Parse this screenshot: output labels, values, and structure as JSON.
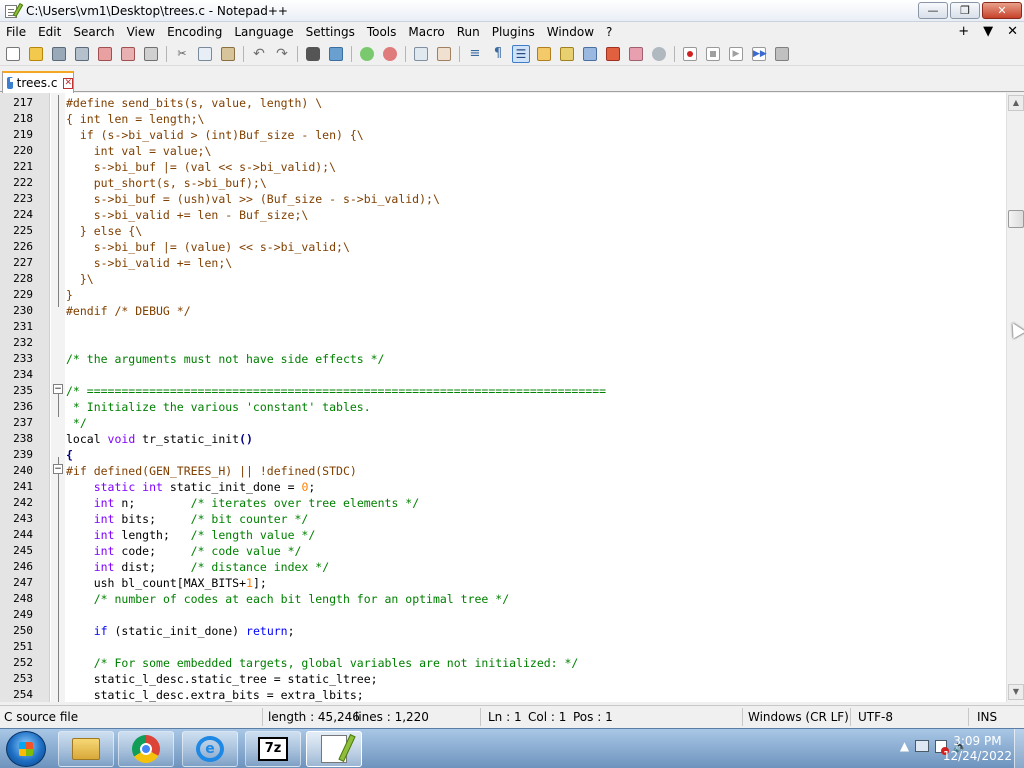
{
  "window": {
    "title": "C:\\Users\\vm1\\Desktop\\trees.c - Notepad++",
    "controls": {
      "minimize": "—",
      "maximize": "❐",
      "close": "✕"
    }
  },
  "menubar": {
    "items": [
      "File",
      "Edit",
      "Search",
      "View",
      "Encoding",
      "Language",
      "Settings",
      "Tools",
      "Macro",
      "Run",
      "Plugins",
      "Window",
      "?"
    ],
    "right": {
      "plus": "+",
      "down": "▼",
      "close": "✕"
    }
  },
  "toolbar": {
    "icons": [
      "new-file-icon",
      "open-file-icon",
      "save-icon",
      "save-all-icon",
      "close-icon",
      "close-all-icon",
      "print-icon",
      "cut-icon",
      "copy-icon",
      "paste-icon",
      "undo-icon",
      "redo-icon",
      "find-icon",
      "replace-icon",
      "zoom-in-icon",
      "zoom-out-icon",
      "sync-vertical-icon",
      "sync-horizontal-icon",
      "word-wrap-icon",
      "show-all-characters-icon",
      "indent-guide-icon",
      "user-defined-language-icon",
      "document-map-icon",
      "document-list-icon",
      "function-list-icon",
      "folder-as-workspace-icon",
      "monitoring-icon",
      "record-macro-icon",
      "stop-recording-icon",
      "playback-macro-icon",
      "run-macro-multiple-icon",
      "save-macro-icon"
    ]
  },
  "tab": {
    "label": "trees.c",
    "close": "✕"
  },
  "editor": {
    "lines": [
      {
        "n": "217",
        "t": [
          [
            "pp",
            "#define send_bits(s, value, length) \\"
          ]
        ]
      },
      {
        "n": "218",
        "t": [
          [
            "pp",
            "{ int len = length;\\"
          ]
        ]
      },
      {
        "n": "219",
        "t": [
          [
            "pp",
            "  if (s->bi_valid > (int)Buf_size - len) {\\"
          ]
        ]
      },
      {
        "n": "220",
        "t": [
          [
            "pp",
            "    int val = value;\\"
          ]
        ]
      },
      {
        "n": "221",
        "t": [
          [
            "pp",
            "    s->bi_buf |= (val << s->bi_valid);\\"
          ]
        ]
      },
      {
        "n": "222",
        "t": [
          [
            "pp",
            "    put_short(s, s->bi_buf);\\"
          ]
        ]
      },
      {
        "n": "223",
        "t": [
          [
            "pp",
            "    s->bi_buf = (ush)val >> (Buf_size - s->bi_valid);\\"
          ]
        ]
      },
      {
        "n": "224",
        "t": [
          [
            "pp",
            "    s->bi_valid += len - Buf_size;\\"
          ]
        ]
      },
      {
        "n": "225",
        "t": [
          [
            "pp",
            "  } else {\\"
          ]
        ]
      },
      {
        "n": "226",
        "t": [
          [
            "pp",
            "    s->bi_buf |= (value) << s->bi_valid;\\"
          ]
        ]
      },
      {
        "n": "227",
        "t": [
          [
            "pp",
            "    s->bi_valid += len;\\"
          ]
        ]
      },
      {
        "n": "228",
        "t": [
          [
            "pp",
            "  }\\"
          ]
        ]
      },
      {
        "n": "229",
        "t": [
          [
            "pp",
            "}"
          ]
        ]
      },
      {
        "n": "230",
        "t": [
          [
            "pp",
            "#endif /* DEBUG */"
          ]
        ]
      },
      {
        "n": "231",
        "t": []
      },
      {
        "n": "232",
        "t": []
      },
      {
        "n": "233",
        "t": [
          [
            "cm",
            "/* the arguments must not have side effects */"
          ]
        ]
      },
      {
        "n": "234",
        "t": []
      },
      {
        "n": "235",
        "t": [
          [
            "cm",
            "/* ==========================================================================="
          ]
        ]
      },
      {
        "n": "236",
        "t": [
          [
            "cm",
            " * Initialize the various 'constant' tables."
          ]
        ]
      },
      {
        "n": "237",
        "t": [
          [
            "cm",
            " */"
          ]
        ]
      },
      {
        "n": "238",
        "t": [
          [
            "tx",
            "local "
          ],
          [
            "kw",
            "void"
          ],
          [
            "tx",
            " tr_static_init"
          ],
          [
            "bd",
            "()"
          ]
        ]
      },
      {
        "n": "239",
        "t": [
          [
            "bd",
            "{"
          ]
        ]
      },
      {
        "n": "240",
        "t": [
          [
            "pp",
            "#if defined(GEN_TREES_H) || !defined(STDC)"
          ]
        ]
      },
      {
        "n": "241",
        "t": [
          [
            "tx",
            "    "
          ],
          [
            "kw",
            "static int"
          ],
          [
            "tx",
            " static_init_done = "
          ],
          [
            "nm",
            "0"
          ],
          [
            "tx",
            ";"
          ]
        ]
      },
      {
        "n": "242",
        "t": [
          [
            "tx",
            "    "
          ],
          [
            "kw",
            "int"
          ],
          [
            "tx",
            " n;        "
          ],
          [
            "cm",
            "/* iterates over tree elements */"
          ]
        ]
      },
      {
        "n": "243",
        "t": [
          [
            "tx",
            "    "
          ],
          [
            "kw",
            "int"
          ],
          [
            "tx",
            " bits;     "
          ],
          [
            "cm",
            "/* bit counter */"
          ]
        ]
      },
      {
        "n": "244",
        "t": [
          [
            "tx",
            "    "
          ],
          [
            "kw",
            "int"
          ],
          [
            "tx",
            " length;   "
          ],
          [
            "cm",
            "/* length value */"
          ]
        ]
      },
      {
        "n": "245",
        "t": [
          [
            "tx",
            "    "
          ],
          [
            "kw",
            "int"
          ],
          [
            "tx",
            " code;     "
          ],
          [
            "cm",
            "/* code value */"
          ]
        ]
      },
      {
        "n": "246",
        "t": [
          [
            "tx",
            "    "
          ],
          [
            "kw",
            "int"
          ],
          [
            "tx",
            " dist;     "
          ],
          [
            "cm",
            "/* distance index */"
          ]
        ]
      },
      {
        "n": "247",
        "t": [
          [
            "tx",
            "    ush bl_count[MAX_BITS+"
          ],
          [
            "nm",
            "1"
          ],
          [
            "tx",
            "];"
          ]
        ]
      },
      {
        "n": "248",
        "t": [
          [
            "tx",
            "    "
          ],
          [
            "cm",
            "/* number of codes at each bit length for an optimal tree */"
          ]
        ]
      },
      {
        "n": "249",
        "t": []
      },
      {
        "n": "250",
        "t": [
          [
            "tx",
            "    "
          ],
          [
            "bl",
            "if"
          ],
          [
            "tx",
            " (static_init_done) "
          ],
          [
            "bl",
            "return"
          ],
          [
            "tx",
            ";"
          ]
        ]
      },
      {
        "n": "251",
        "t": []
      },
      {
        "n": "252",
        "t": [
          [
            "tx",
            "    "
          ],
          [
            "cm",
            "/* For some embedded targets, global variables are not initialized: */"
          ]
        ]
      },
      {
        "n": "253",
        "t": [
          [
            "tx",
            "    static_l_desc.static_tree = static_ltree;"
          ]
        ]
      },
      {
        "n": "254",
        "t": [
          [
            "tx",
            "    static_l_desc.extra_bits = extra_lbits;"
          ]
        ]
      }
    ]
  },
  "statusbar": {
    "filetype": "C source file",
    "length": "length : 45,246",
    "lines": "lines : 1,220",
    "ln": "Ln : 1",
    "col": "Col : 1",
    "pos": "Pos : 1",
    "eol": "Windows (CR LF)",
    "encoding": "UTF-8",
    "mode": "INS"
  },
  "taskbar": {
    "apps": [
      "file-explorer-icon",
      "chrome-icon",
      "internet-explorer-icon",
      "7zip-icon",
      "notepadpp-icon"
    ],
    "sevenzip_label": "7z",
    "clock_time": "3:09 PM",
    "clock_date": "12/24/2022"
  },
  "colors": {
    "preprocessor": "#804000",
    "keyword": "#8000ff",
    "comment": "#008000",
    "number": "#ff8000",
    "instruction": "#0000ff",
    "tab_accent": "#f5a623"
  }
}
